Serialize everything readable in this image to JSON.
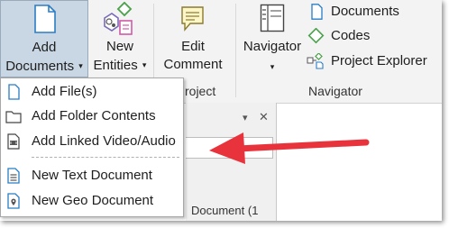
{
  "ribbon": {
    "add_documents": {
      "line1": "Add",
      "line2": "Documents",
      "caret": "▾"
    },
    "new_entities": {
      "line1": "New",
      "line2": "Entities",
      "caret": "▾"
    },
    "edit_comment": {
      "line1": "Edit",
      "line2": "Comment"
    },
    "navigator_button": {
      "label": "Navigator",
      "caret": "▾"
    },
    "nav_items": [
      {
        "label": "Documents",
        "icon": "document-icon"
      },
      {
        "label": "Codes",
        "icon": "code-diamond-icon"
      },
      {
        "label": "Project Explorer",
        "icon": "project-explorer-icon"
      }
    ],
    "groups": {
      "project_partial": "roject",
      "navigator": "Navigator"
    }
  },
  "add_documents_menu": {
    "items": [
      {
        "label": "Add File(s)",
        "icon": "file-icon"
      },
      {
        "label": "Add Folder Contents",
        "icon": "folder-icon"
      },
      {
        "label": "Add Linked Video/Audio",
        "icon": "film-icon"
      },
      {
        "label": "New Text Document",
        "icon": "text-document-icon"
      },
      {
        "label": "New Geo Document",
        "icon": "geo-document-icon"
      }
    ]
  },
  "side_panel": {
    "dropdown_glyph": "▾",
    "close_glyph": "✕",
    "partial_text": "Document (1"
  },
  "colors": {
    "accent_red": "#e8333c",
    "ribbon_bg": "#f3f3f3",
    "active_button_bg": "#c9d6e3",
    "icon_blue": "#2a7dc4",
    "icon_green": "#4aa24a",
    "icon_pink": "#d05aa8"
  }
}
